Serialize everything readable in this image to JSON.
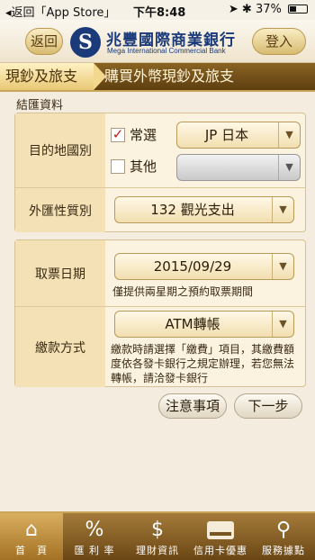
{
  "status_bar": {
    "back_app": "◂返回「App Store」",
    "time": "下午8:48",
    "right": "➤ ✱ 37%",
    "battery_level": 0.37
  },
  "header": {
    "back_label": "返回",
    "bank_name_cn": "兆豐國際商業銀行",
    "bank_name_en": "Mega International Commercial Bank",
    "login_label": "登入"
  },
  "breadcrumb": {
    "level1": "現鈔及旅支",
    "level2": "購買外幣現鈔及旅支"
  },
  "section_title": "結匯資料",
  "form": {
    "destination": {
      "label": "目的地國別",
      "frequent_label": "常選",
      "frequent_checked": true,
      "frequent_value": "JP 日本",
      "other_label": "其他",
      "other_checked": false,
      "other_value": ""
    },
    "fx_nature": {
      "label": "外匯性質別",
      "value": "132 觀光支出"
    },
    "pickup_date": {
      "label": "取票日期",
      "value": "2015/09/29",
      "note": "僅提供兩星期之預約取票期間"
    },
    "payment": {
      "label": "繳款方式",
      "value": "ATM轉帳",
      "note": "繳款時請選擇「繳費」項目，其繳費額度依各發卡銀行之規定辦理，若您無法轉帳，請洽發卡銀行"
    }
  },
  "buttons": {
    "notice": "注意事項",
    "next": "下一步"
  },
  "tabbar": [
    {
      "icon": "home-icon",
      "glyph": "⌂",
      "label": "首　頁"
    },
    {
      "icon": "percent-icon",
      "glyph": "%",
      "label": "匯 利 率"
    },
    {
      "icon": "dollar-icon",
      "glyph": "$",
      "label": "理財資訊"
    },
    {
      "icon": "card-icon",
      "glyph": "CARD",
      "label": "信用卡優惠"
    },
    {
      "icon": "location-pin-icon",
      "glyph": "⚲",
      "label": "服務據點"
    }
  ],
  "colors": {
    "brand_blue": "#1a3a7a",
    "gold": "#c9a55a",
    "brown": "#6a4614",
    "check_red": "#c01818"
  }
}
